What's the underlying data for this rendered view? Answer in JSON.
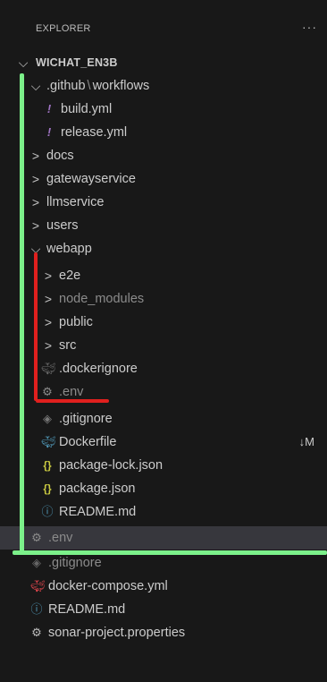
{
  "explorer": {
    "title": "EXPLORER",
    "more_icon": "ellipsis-icon"
  },
  "tree": {
    "root": "WICHAT_EN3B",
    "github": {
      "name": ".github",
      "sep": "\\",
      "sub": "workflows"
    },
    "build_yml": "build.yml",
    "release_yml": "release.yml",
    "docs": "docs",
    "gatewayservice": "gatewayservice",
    "llmservice": "llmservice",
    "users": "users",
    "webapp": "webapp",
    "e2e": "e2e",
    "node_modules": "node_modules",
    "public": "public",
    "src": "src",
    "webapp_dockerignore": ".dockerignore",
    "webapp_env": ".env",
    "webapp_gitignore": ".gitignore",
    "webapp_dockerfile": "Dockerfile",
    "webapp_dockerfile_badge": "↓M",
    "package_lock": "package-lock.json",
    "package_json": "package.json",
    "webapp_readme": "README.md",
    "root_env": ".env",
    "root_gitignore": ".gitignore",
    "docker_compose": "docker-compose.yml",
    "root_readme": "README.md",
    "sonar": "sonar-project.properties"
  },
  "colors": {
    "background": "#181818",
    "selected_row": "#37373d",
    "yaml_icon": "#a074c4",
    "docker_icon": "#519aba",
    "json_icon": "#cbcb41",
    "info_icon": "#519aba",
    "compose_icon": "#e8474f",
    "annotation_red": "#e0201e",
    "annotation_green": "#7cf08a"
  }
}
